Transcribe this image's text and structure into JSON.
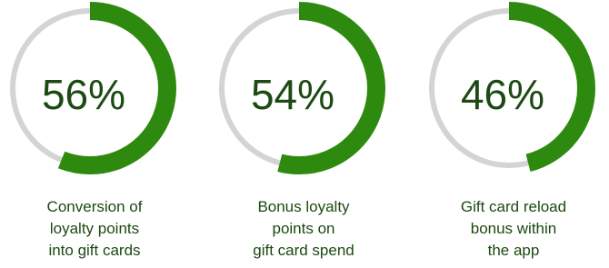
{
  "chart_data": {
    "type": "gauge",
    "colors": {
      "value": "#2d8a0e",
      "track": "#d4d4d4",
      "text": "#1c4a12"
    },
    "items": [
      {
        "value": 56,
        "display": "56%",
        "label_lines": [
          "Conversion of",
          "loyalty points",
          "into gift cards"
        ]
      },
      {
        "value": 54,
        "display": "54%",
        "label_lines": [
          "Bonus loyalty",
          "points on",
          "gift card spend"
        ]
      },
      {
        "value": 46,
        "display": "46%",
        "label_lines": [
          "Gift card reload",
          "bonus within",
          "the app"
        ]
      }
    ]
  }
}
